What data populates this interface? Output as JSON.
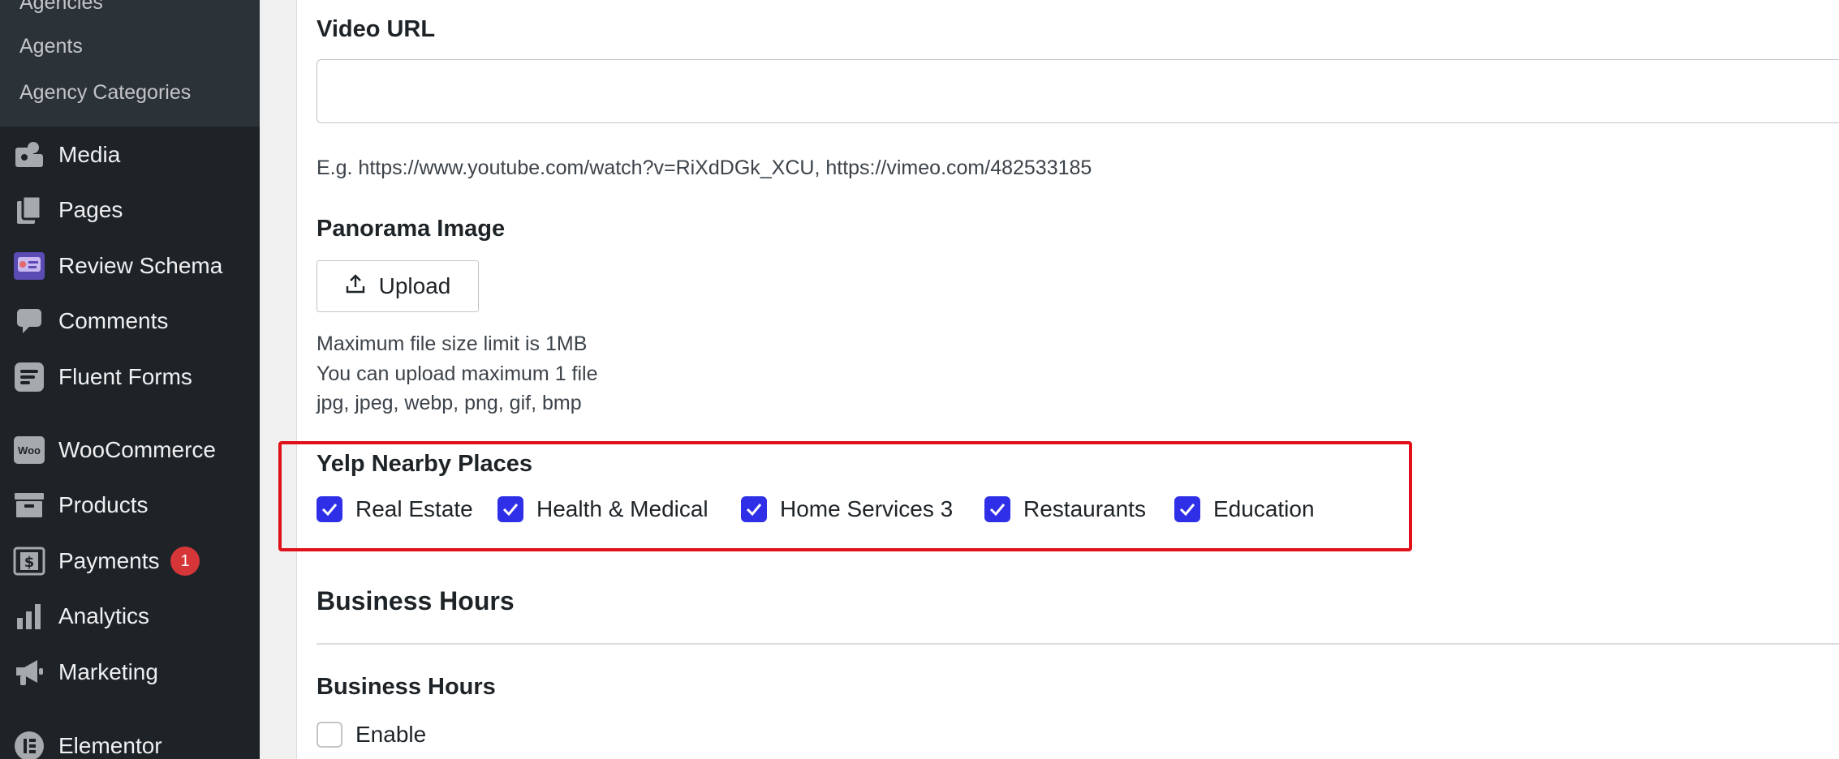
{
  "sidebar": {
    "submenu": [
      "Agencies",
      "Agents",
      "Agency Categories"
    ],
    "items": [
      {
        "label": "Media",
        "icon": "media-icon"
      },
      {
        "label": "Pages",
        "icon": "pages-icon"
      },
      {
        "label": "Review Schema",
        "icon": "review-schema-icon"
      },
      {
        "label": "Comments",
        "icon": "comments-icon"
      },
      {
        "label": "Fluent Forms",
        "icon": "fluent-forms-icon"
      },
      {
        "label": "WooCommerce",
        "icon": "woocommerce-icon",
        "icon_text": "Woo"
      },
      {
        "label": "Products",
        "icon": "products-icon"
      },
      {
        "label": "Payments",
        "icon": "payments-icon",
        "badge": "1"
      },
      {
        "label": "Analytics",
        "icon": "analytics-icon"
      },
      {
        "label": "Marketing",
        "icon": "marketing-icon"
      },
      {
        "label": "Elementor",
        "icon": "elementor-icon"
      }
    ]
  },
  "form": {
    "video_url": {
      "label": "Video URL",
      "value": "",
      "help": "E.g. https://www.youtube.com/watch?v=RiXdDGk_XCU, https://vimeo.com/482533185"
    },
    "panorama": {
      "label": "Panorama Image",
      "upload_label": "Upload",
      "help": [
        "Maximum file size limit is 1MB",
        "You can upload maximum 1 file",
        "jpg, jpeg, webp, png, gif, bmp"
      ]
    },
    "yelp": {
      "label": "Yelp Nearby Places",
      "options": [
        {
          "label": "Real Estate",
          "checked": true
        },
        {
          "label": "Health & Medical",
          "checked": true
        },
        {
          "label": "Home Services 3",
          "checked": true
        },
        {
          "label": "Restaurants",
          "checked": true
        },
        {
          "label": "Education",
          "checked": true
        }
      ]
    },
    "business_hours": {
      "section_title": "Business Hours",
      "label": "Business Hours",
      "enable_label": "Enable",
      "enabled": false
    }
  },
  "colors": {
    "sidebar_bg": "#1d2327",
    "submenu_bg": "#2c3338",
    "checkbox_accent": "#2f2fe8",
    "highlight_border": "#e0101a",
    "badge": "#d63638"
  }
}
